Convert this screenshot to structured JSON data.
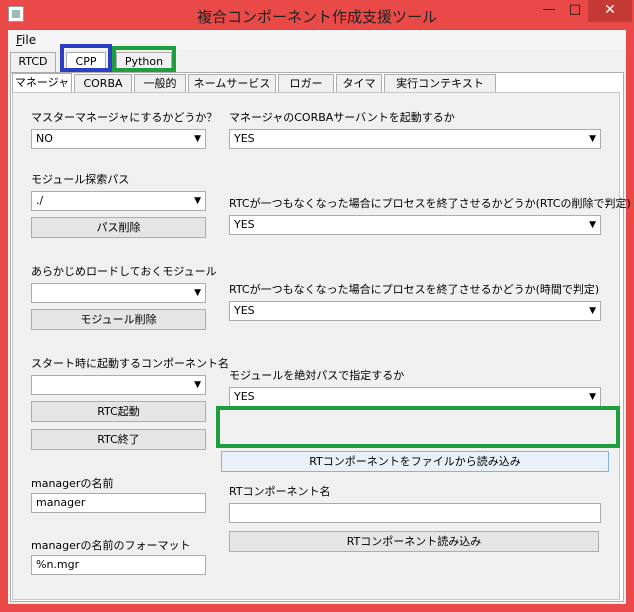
{
  "window": {
    "title": "複合コンポーネント作成支援ツール",
    "minimize": "—",
    "maximize": "□",
    "close": "✕"
  },
  "menu": {
    "file_label": "File",
    "file_label_rest": "ile",
    "file_mnemonic": "F"
  },
  "top_tabs": [
    "RTCD",
    "CPP",
    "Python"
  ],
  "sub_tabs": [
    "マネージャ",
    "CORBA",
    "一般的",
    "ネームサービス",
    "ロガー",
    "タイマ",
    "実行コンテキスト"
  ],
  "left": {
    "master_label": "マスターマネージャにするかどうか？",
    "master_value": "NO",
    "module_path_label": "モジュール探索パス",
    "module_path_value": "./",
    "path_delete": "パス削除",
    "preload_label": "あらかじめロードしておくモジュール",
    "preload_value": "",
    "module_delete": "モジュール削除",
    "startup_label": "スタート時に起動するコンポーネント名",
    "startup_value": "",
    "rtc_start": "RTC起動",
    "rtc_end": "RTC終了",
    "manager_name_label": "managerの名前",
    "manager_name_value": "manager",
    "manager_format_label": "managerの名前のフォーマット",
    "manager_format_value": "%n.mgr"
  },
  "right": {
    "corba_servant_label": "マネージャのCORBAサーバントを起動するか",
    "corba_servant_value": "YES",
    "shutdown_delete_label": "RTCが一つもなくなった場合にプロセスを終了させるかどうか(RTCの削除で判定)",
    "shutdown_delete_value": "YES",
    "shutdown_time_label": "RTCが一つもなくなった場合にプロセスを終了させるかどうか(時間で判定)",
    "shutdown_time_value": "YES",
    "abs_path_label": "モジュールを絶対パスで指定するか",
    "abs_path_value": "YES",
    "load_from_file": "RTコンポーネントをファイルから読み込み",
    "rtc_name_label": "RTコンポーネント名",
    "rtc_name_value": "",
    "rtc_load": "RTコンポーネント読み込み"
  },
  "icons": {
    "dropdown": "chevron-down-icon",
    "app": "app-icon"
  },
  "colors": {
    "highlight_blue": "#2c3ec4",
    "highlight_green": "#1e9e3c",
    "window_frame": "#ea4a47"
  }
}
